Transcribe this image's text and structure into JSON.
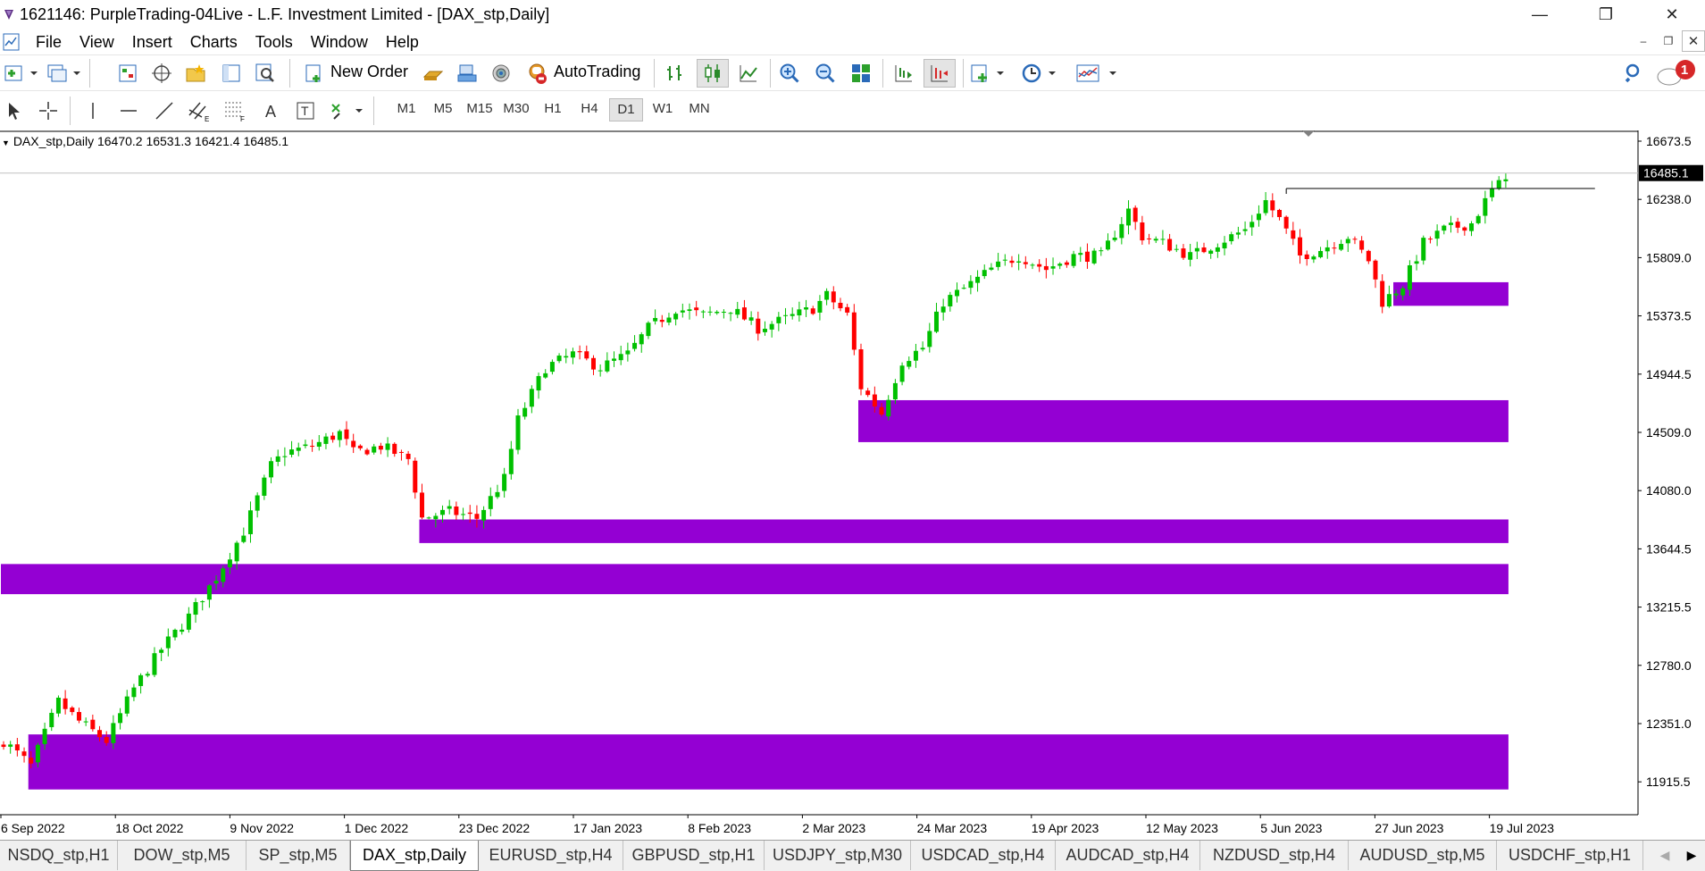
{
  "window": {
    "title": "1621146: PurpleTrading-04Live - L.F. Investment Limited - [DAX_stp,Daily]",
    "minimize": "—",
    "maximize": "❐",
    "close": "✕"
  },
  "menu": {
    "items": [
      "File",
      "View",
      "Insert",
      "Charts",
      "Tools",
      "Window",
      "Help"
    ]
  },
  "toolbar": {
    "new_order": "New Order",
    "autotrading": "AutoTrading",
    "timeframes": [
      "M1",
      "M5",
      "M15",
      "M30",
      "H1",
      "H4",
      "D1",
      "W1",
      "MN"
    ],
    "active_timeframe": "D1",
    "notification_count": "1"
  },
  "chart": {
    "legend": "DAX_stp,Daily  16470.2 16531.3 16421.4 16485.1",
    "symbol": "DAX_stp",
    "period": "Daily",
    "open": 16470.2,
    "high": 16531.3,
    "low": 16421.4,
    "close": 16485.1,
    "current_price_label": "16485.1",
    "price_ticks": [
      "16673.5",
      "16238.0",
      "15809.0",
      "15373.5",
      "14944.5",
      "14509.0",
      "14080.0",
      "13644.5",
      "13215.5",
      "12780.0",
      "12351.0",
      "11915.5"
    ],
    "date_ticks": [
      "6 Sep 2022",
      "18 Oct 2022",
      "9 Nov 2022",
      "1 Dec 2022",
      "23 Dec 2022",
      "17 Jan 2023",
      "8 Feb 2023",
      "2 Mar 2023",
      "24 Mar 2023",
      "19 Apr 2023",
      "12 May 2023",
      "5 Jun 2023",
      "27 Jun 2023",
      "19 Jul 2023"
    ],
    "colors": {
      "bull": "#00c000",
      "bear": "#ff0000",
      "zone": "#9400d3",
      "axis": "#000000"
    },
    "horizontal_line_price": 16485.1
  },
  "chart_data": {
    "type": "candlestick",
    "symbol": "DAX_stp",
    "timeframe": "Daily",
    "ylim": [
      11760,
      16790
    ],
    "x": [
      "6 Sep 2022",
      "18 Oct 2022",
      "9 Nov 2022",
      "1 Dec 2022",
      "23 Dec 2022",
      "17 Jan 2023",
      "8 Feb 2023",
      "2 Mar 2023",
      "24 Mar 2023",
      "19 Apr 2023",
      "12 May 2023",
      "5 Jun 2023",
      "27 Jun 2023",
      "19 Jul 2023"
    ],
    "close_path": [
      [
        0,
        12200
      ],
      [
        4,
        12010
      ],
      [
        8,
        12500
      ],
      [
        11,
        12350
      ],
      [
        15,
        12200
      ],
      [
        19,
        12600
      ],
      [
        23,
        12900
      ],
      [
        27,
        13150
      ],
      [
        31,
        13450
      ],
      [
        35,
        13800
      ],
      [
        39,
        14300
      ],
      [
        41,
        14400
      ],
      [
        45,
        14450
      ],
      [
        49,
        14550
      ],
      [
        51,
        14400
      ],
      [
        55,
        14450
      ],
      [
        59,
        14350
      ],
      [
        61,
        13900
      ],
      [
        65,
        13950
      ],
      [
        69,
        13900
      ],
      [
        73,
        14200
      ],
      [
        75,
        14650
      ],
      [
        79,
        15050
      ],
      [
        83,
        15150
      ],
      [
        87,
        15050
      ],
      [
        91,
        15150
      ],
      [
        94,
        15350
      ],
      [
        98,
        15500
      ],
      [
        102,
        15450
      ],
      [
        106,
        15500
      ],
      [
        110,
        15350
      ],
      [
        114,
        15420
      ],
      [
        118,
        15500
      ],
      [
        120,
        15600
      ],
      [
        123,
        15450
      ],
      [
        125,
        14900
      ],
      [
        128,
        14700
      ],
      [
        131,
        15100
      ],
      [
        134,
        15200
      ],
      [
        137,
        15550
      ],
      [
        140,
        15650
      ],
      [
        144,
        15800
      ],
      [
        148,
        15900
      ],
      [
        152,
        15800
      ],
      [
        156,
        15900
      ],
      [
        160,
        15900
      ],
      [
        164,
        16250
      ],
      [
        166,
        16050
      ],
      [
        169,
        16000
      ],
      [
        173,
        15900
      ],
      [
        177,
        16000
      ],
      [
        181,
        16100
      ],
      [
        184,
        16320
      ],
      [
        186,
        16180
      ],
      [
        189,
        15900
      ],
      [
        192,
        15950
      ],
      [
        196,
        16050
      ],
      [
        199,
        15870
      ],
      [
        201,
        15550
      ],
      [
        204,
        15680
      ],
      [
        207,
        16000
      ],
      [
        210,
        16100
      ],
      [
        214,
        16150
      ],
      [
        217,
        16400
      ],
      [
        219,
        16485
      ]
    ],
    "zones": [
      {
        "from_x": 125,
        "to_x": 219,
        "top": 14800,
        "bottom": 14480
      },
      {
        "from_x": 61,
        "to_x": 219,
        "top": 13890,
        "bottom": 13710
      },
      {
        "from_x": 0,
        "to_x": 219,
        "top": 13550,
        "bottom": 13320
      },
      {
        "from_x": 4,
        "to_x": 219,
        "top": 12250,
        "bottom": 11830
      },
      {
        "from_x": 203,
        "to_x": 219,
        "top": 15700,
        "bottom": 15520
      }
    ],
    "hline": {
      "from_x": 187,
      "to_x": 232,
      "price": 16415
    },
    "last": {
      "open": 16470.2,
      "high": 16531.3,
      "low": 16421.4,
      "close": 16485.1
    }
  },
  "tabs": {
    "items": [
      "NSDQ_stp,H1",
      "DOW_stp,M5",
      "SP_stp,M5",
      "DAX_stp,Daily",
      "EURUSD_stp,H4",
      "GBPUSD_stp,H1",
      "USDJPY_stp,M30",
      "USDCAD_stp,H4",
      "AUDCAD_stp,H4",
      "NZDUSD_stp,H4",
      "AUDUSD_stp,M5",
      "USDCHF_stp,H1"
    ],
    "active": "DAX_stp,Daily",
    "prev": "◀",
    "next": "▶"
  }
}
